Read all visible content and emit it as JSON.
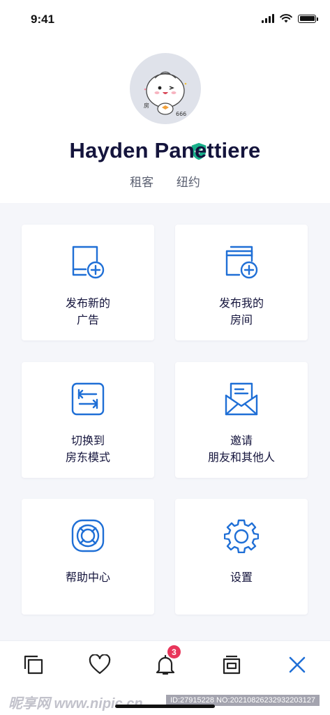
{
  "status": {
    "time": "9:41"
  },
  "profile": {
    "name": "Hayden Panettiere",
    "role": "租客",
    "city": "纽约"
  },
  "cards": [
    {
      "line1": "发布新的",
      "line2": "广告",
      "icon": "new-ad-icon"
    },
    {
      "line1": "发布我的",
      "line2": "房间",
      "icon": "publish-room-icon"
    },
    {
      "line1": "切换到",
      "line2": "房东模式",
      "icon": "switch-mode-icon"
    },
    {
      "line1": "邀请",
      "line2": "朋友和其他人",
      "icon": "invite-mail-icon"
    },
    {
      "line1": "帮助中心",
      "line2": "",
      "icon": "help-lifebuoy-icon"
    },
    {
      "line1": "设置",
      "line2": "",
      "icon": "settings-gear-icon"
    }
  ],
  "tabbar": {
    "notifications_badge": "3",
    "items": [
      "copy-icon",
      "heart-icon",
      "bell-icon",
      "archive-icon",
      "close-icon"
    ]
  },
  "watermark": {
    "left": "昵享网 www.nipic.cn",
    "right": "ID:27915228 NO:20210826232932203127"
  },
  "colors": {
    "accent": "#1f6fd6",
    "shield": "#19b08a",
    "badge": "#e8355a",
    "title": "#14143c"
  }
}
